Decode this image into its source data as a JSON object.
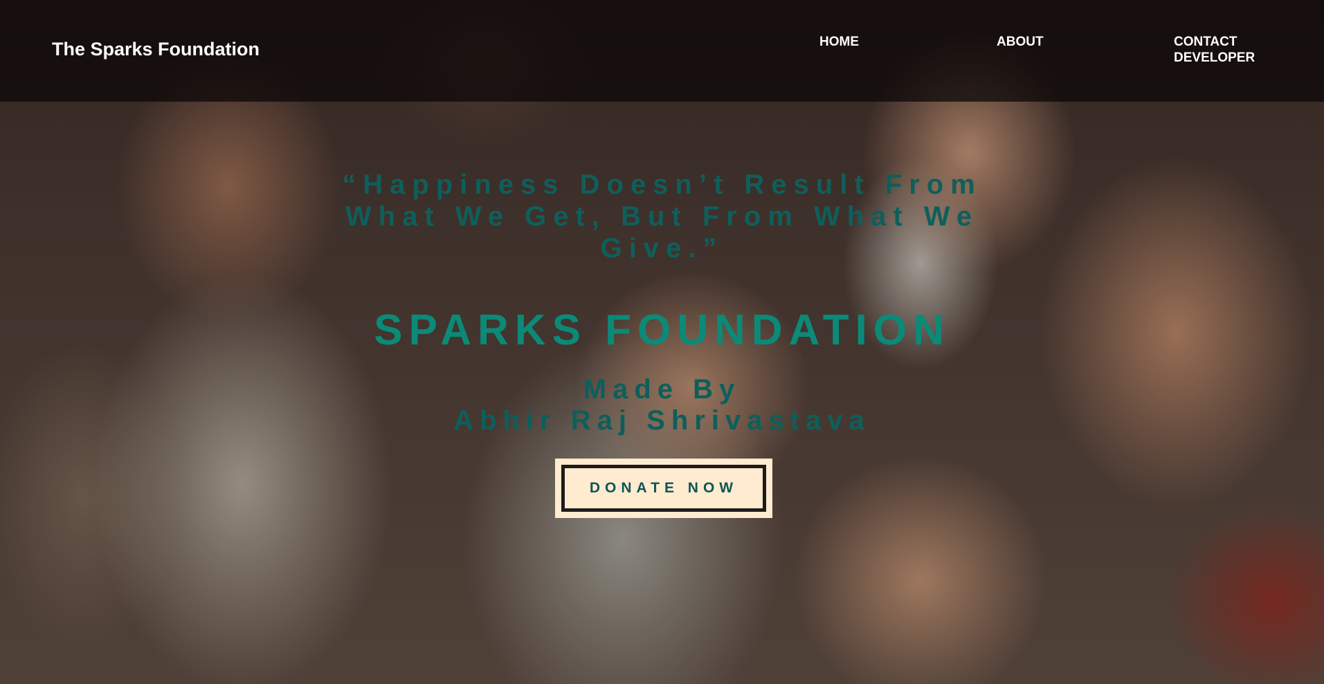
{
  "navbar": {
    "brand": "The Sparks Foundation",
    "links": [
      {
        "label": "HOME"
      },
      {
        "label": "ABOUT"
      },
      {
        "label": "CONTACT\nDEVELOPER"
      }
    ]
  },
  "hero": {
    "background_image": "children-smiling-group-photo",
    "quote": "“Happiness Doesn’t Result From What We Get, But From What We Give.”",
    "title": "SPARKS FOUNDATION",
    "made_by_line1": "Made By",
    "made_by_line2": "Abhir Raj Shrivastava",
    "donate_label": "DONATE NOW"
  },
  "colors": {
    "navbar_bg": "#0a0606",
    "quote_text": "#0e5f5b",
    "title_text": "#0b8a78",
    "button_bg": "#ffebd0",
    "button_border": "#1c1c1a"
  }
}
